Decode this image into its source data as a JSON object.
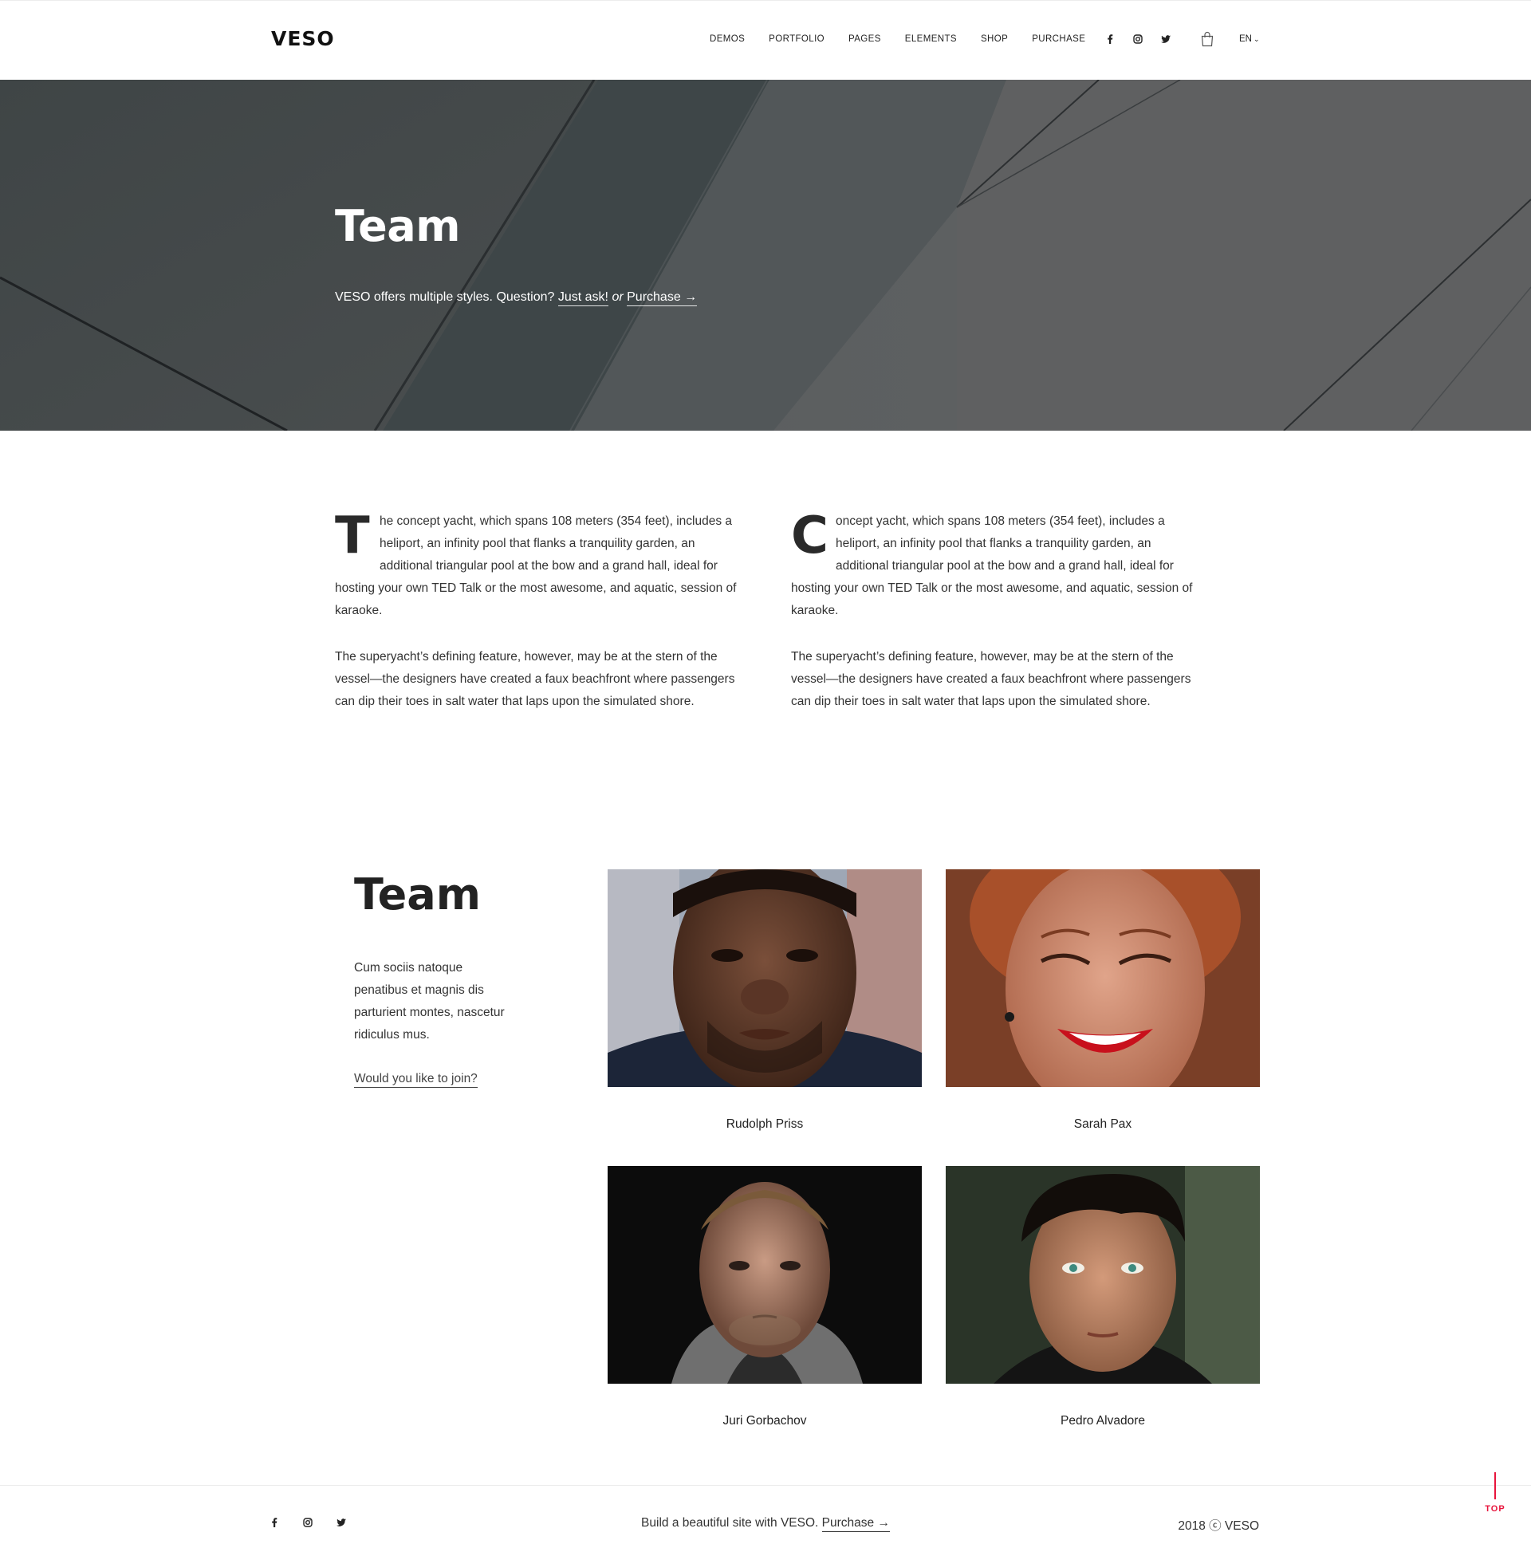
{
  "header": {
    "logo": "VESO",
    "nav": [
      "DEMOS",
      "PORTFOLIO",
      "PAGES",
      "ELEMENTS",
      "SHOP",
      "PURCHASE"
    ],
    "social_icons": [
      "facebook-icon",
      "instagram-icon",
      "twitter-icon"
    ],
    "cart_icon": "shopping-bag-icon",
    "language": "EN"
  },
  "hero": {
    "title": "Team",
    "subtitle_text": "VESO offers multiple styles. Question?",
    "ask_link": "Just ask!",
    "or_text": "or",
    "purchase_link": "Purchase →"
  },
  "intro": {
    "left": {
      "dropcap": "T",
      "p1": "he concept yacht, which spans 108 meters (354 feet), includes a heliport, an infinity pool that flanks a tranquility garden, an additional triangular pool at the bow and a grand hall, ideal for hosting your own TED Talk or the most awesome, and aquatic, session of karaoke.",
      "p2": "The superyacht’s defining feature, however, may be at the stern of the vessel—the designers have created a faux beachfront where passengers can dip their toes in salt water that laps upon the simulated shore."
    },
    "right": {
      "dropcap": "C",
      "p1": "oncept yacht, which spans 108 meters (354 feet), includes a heliport, an infinity pool that flanks a tranquility garden, an additional triangular pool at the bow and a grand hall, ideal for hosting your own TED Talk or the most awesome, and aquatic, session of karaoke.",
      "p2": "The superyacht’s defining feature, however, may be at the stern of the vessel—the designers have created a faux beachfront where passengers can dip their toes in salt water that laps upon the simulated shore."
    }
  },
  "team": {
    "heading": "Team",
    "description": "Cum sociis natoque penatibus et magnis dis parturient montes, nascetur ridiculus mus.",
    "join_link": "Would you like to join?",
    "members": [
      {
        "name": "Rudolph Priss"
      },
      {
        "name": "Sarah Pax"
      },
      {
        "name": "Juri Gorbachov"
      },
      {
        "name": "Pedro Alvadore"
      }
    ]
  },
  "footer": {
    "social_icons": [
      "facebook-icon",
      "instagram-icon",
      "twitter-icon"
    ],
    "tagline": "Build a beautiful site with VESO.",
    "purchase_link": "Purchase →",
    "copyright": "2018 ⓒ VESO",
    "top_label": "TOP"
  },
  "colors": {
    "accent": "#e8143c",
    "hero_bg": "#5b5e5f",
    "text": "#333333"
  }
}
